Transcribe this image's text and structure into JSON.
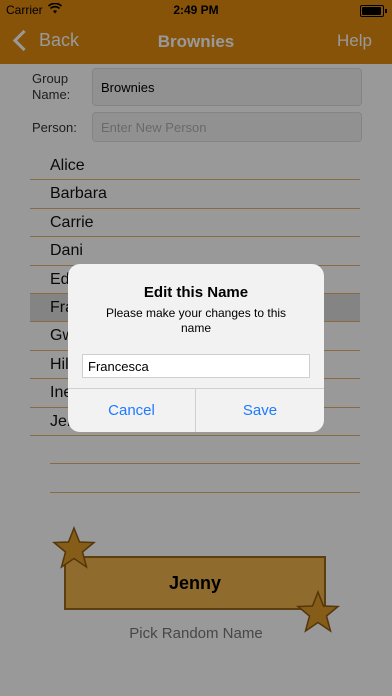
{
  "status": {
    "carrier": "Carrier",
    "time": "2:49 PM"
  },
  "nav": {
    "back": "Back",
    "title": "Brownies",
    "help": "Help"
  },
  "form": {
    "group_label_line1": "Group",
    "group_label_line2": "Name:",
    "group_value": "Brownies",
    "person_label": "Person:",
    "person_placeholder": "Enter New Person"
  },
  "list": {
    "names": [
      "Alice",
      "Barbara",
      "Carrie",
      "Dani",
      "Ed",
      "Fra",
      "Gw",
      "Hil",
      "Ine",
      "Jer"
    ],
    "selected_index": 5
  },
  "random": {
    "name": "Jenny",
    "pick_label": "Pick Random Name"
  },
  "alert": {
    "title": "Edit this Name",
    "message": "Please make your changes to this name",
    "input_value": "Francesca",
    "cancel": "Cancel",
    "save": "Save"
  },
  "colors": {
    "accent": "#e08a10",
    "button_blue": "#1e7bff",
    "star": "#e09a2a"
  }
}
